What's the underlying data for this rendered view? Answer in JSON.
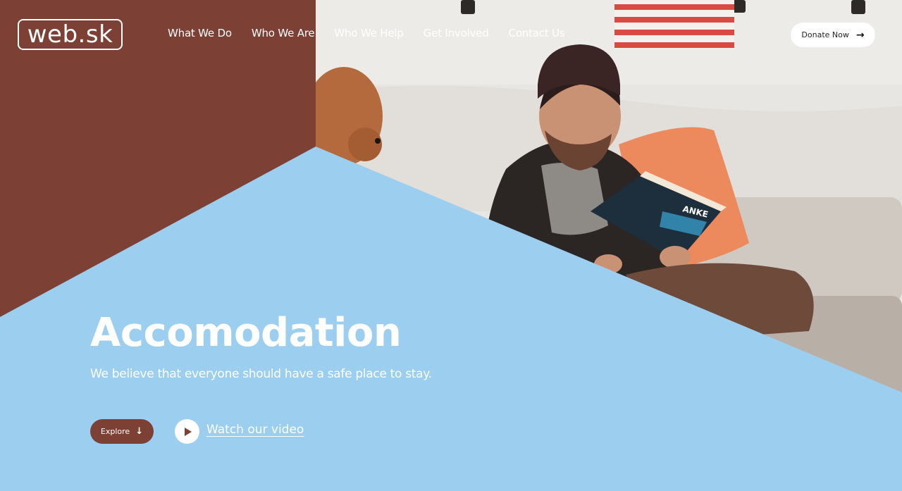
{
  "brand": {
    "logo_text": "web.sk"
  },
  "nav": {
    "items": [
      {
        "label": "What We Do"
      },
      {
        "label": "Who We Are"
      },
      {
        "label": "Who We Help"
      },
      {
        "label": "Get Involved"
      },
      {
        "label": "Contact Us"
      }
    ]
  },
  "header": {
    "donate_label": "Donate Now",
    "donate_icon": "arrow-right-icon"
  },
  "hero": {
    "title": "Accomodation",
    "subtitle": "We believe that everyone should have a safe place to stay.",
    "explore_label": "Explore",
    "explore_icon": "arrow-down-icon",
    "video_label": "Watch our video",
    "video_icon": "play-icon"
  },
  "colors": {
    "brown": "#7d4034",
    "light_blue": "#9ccfef",
    "white": "#ffffff"
  }
}
